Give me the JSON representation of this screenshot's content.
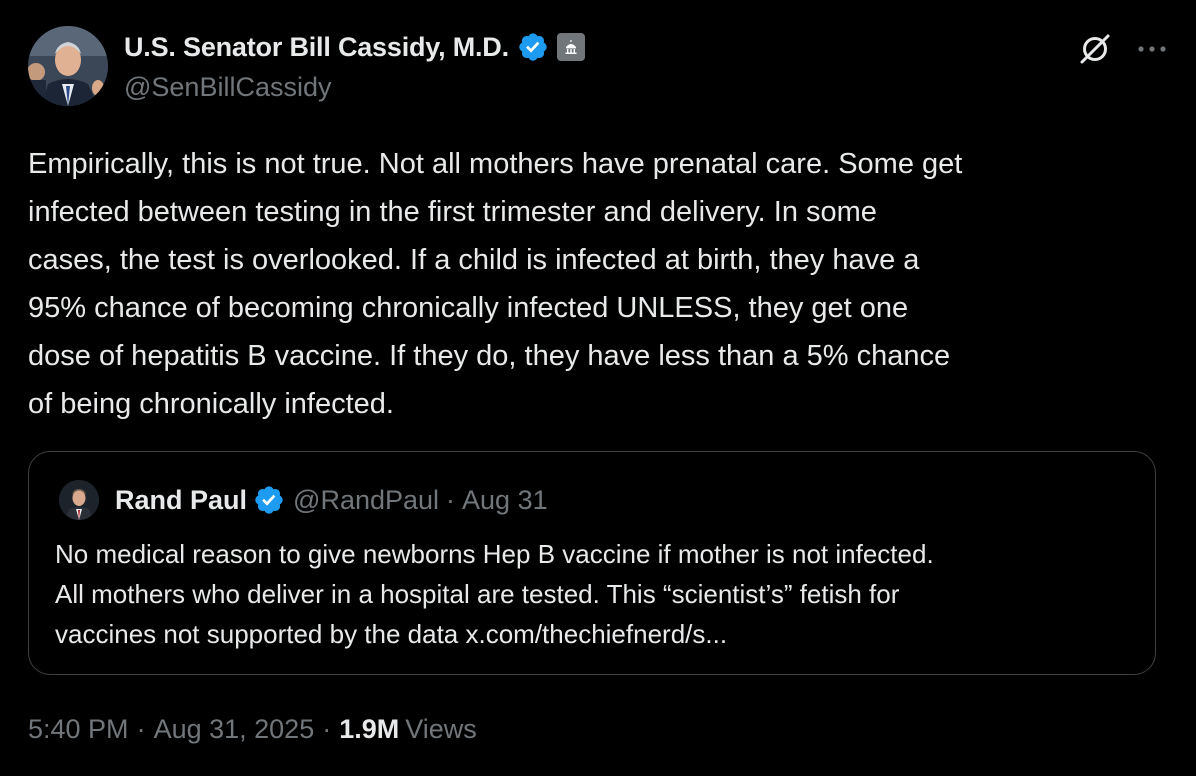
{
  "author": {
    "display_name": "U.S. Senator Bill Cassidy, M.D.",
    "handle": "@SenBillCassidy",
    "verified_icon": "verified-badge-icon",
    "affiliation_icon": "government-building-icon"
  },
  "header_actions": {
    "grok_icon": "grok-icon",
    "more_icon": "more-icon"
  },
  "tweet": {
    "text": "Empirically, this is not true. Not all mothers have prenatal care. Some get\ninfected between testing in the first trimester and delivery. In some\ncases, the test is overlooked. If a child is infected at birth, they have a\n95% chance of becoming chronically infected UNLESS, they get one\ndose of hepatitis B vaccine. If they do, they have less than a 5% chance\nof being chronically infected."
  },
  "quoted_tweet": {
    "display_name": "Rand Paul",
    "handle": "@RandPaul",
    "separator": "·",
    "date": "Aug 31",
    "text": "No medical reason to give newborns Hep B vaccine if mother is not infected.\nAll mothers who deliver in a hospital are tested. This “scientist’s” fetish for\nvaccines not supported by the data x.com/thechiefnerd/s..."
  },
  "meta": {
    "time": "5:40 PM",
    "separator": "·",
    "date": "Aug 31, 2025",
    "views_count": "1.9M",
    "views_label": "Views"
  },
  "colors": {
    "background": "#000000",
    "text": "#e7e9ea",
    "secondary_text": "#71767b",
    "verified_blue": "#1d9bf0",
    "border": "#3e4144"
  }
}
